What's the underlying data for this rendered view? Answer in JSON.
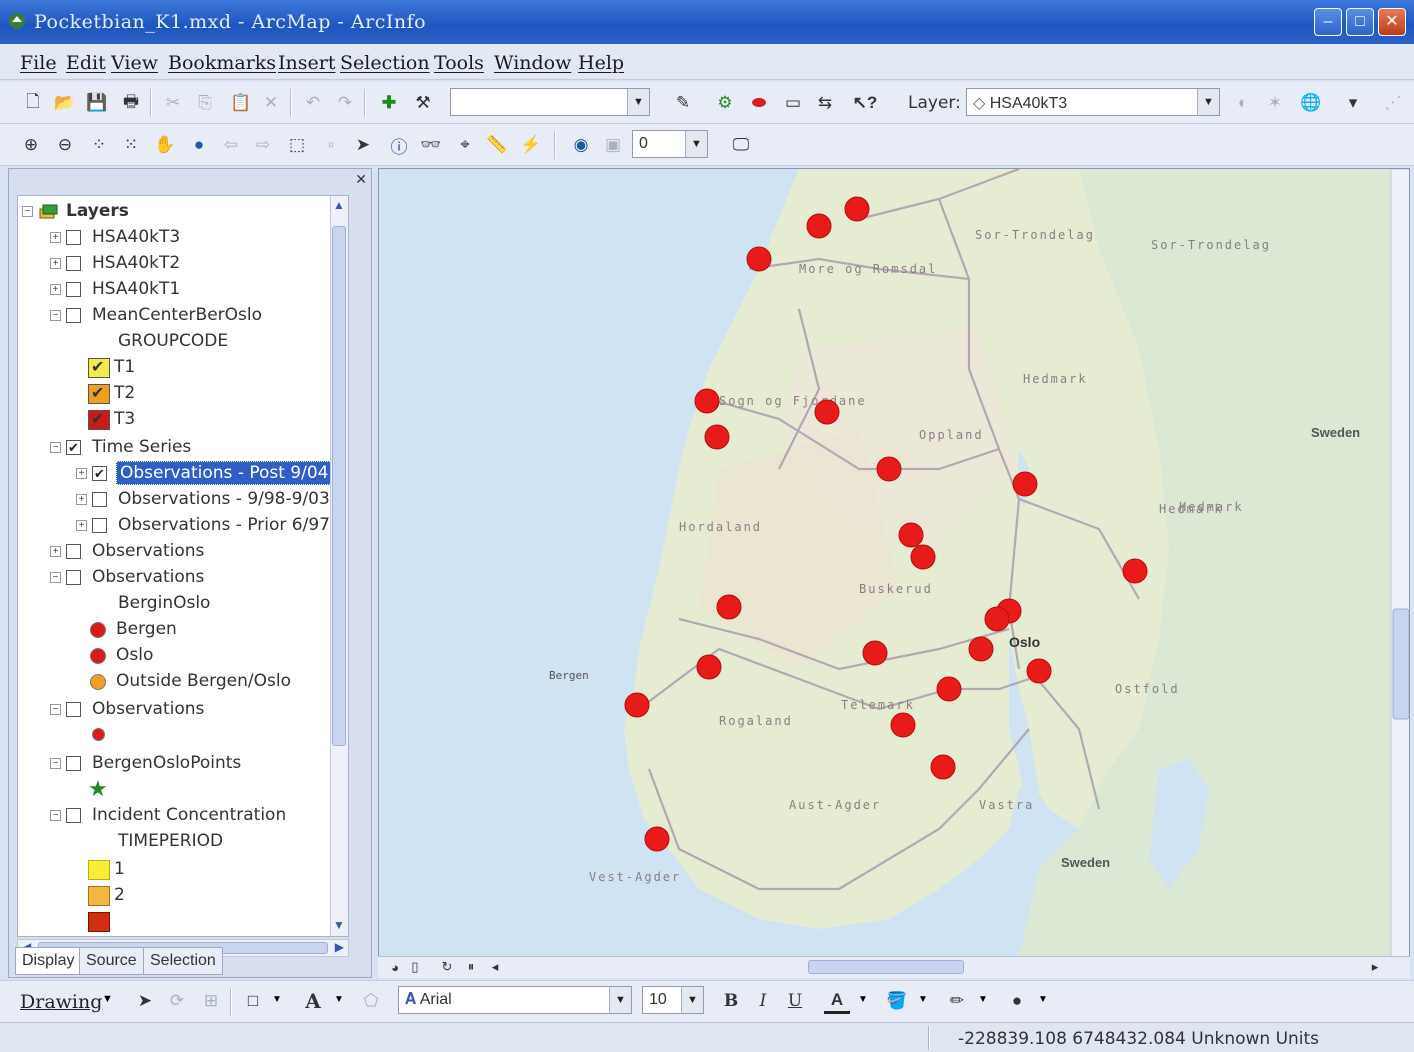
{
  "window": {
    "title": "Pocketbian_K1.mxd - ArcMap - ArcInfo",
    "minimize": "–",
    "maximize": "□",
    "close": "✕"
  },
  "menu": [
    "File",
    "Edit",
    "View",
    "Bookmarks",
    "Insert",
    "Selection",
    "Tools",
    "Window",
    "Help"
  ],
  "toolbar": {
    "layer_label": "Layer:",
    "layer_value": "HSA40kT3",
    "scale_value": "",
    "ref_value": "0"
  },
  "toc": {
    "root": "Layers",
    "rows": [
      {
        "label": "HSA40kT3"
      },
      {
        "label": "HSA40kT2"
      },
      {
        "label": "HSA40kT1"
      },
      {
        "label": "MeanCenterBerOslo"
      },
      {
        "label": "GROUPCODE"
      },
      {
        "label": "T1"
      },
      {
        "label": "T2"
      },
      {
        "label": "T3"
      },
      {
        "label": "Time Series"
      },
      {
        "label": "Observations - Post 9/04"
      },
      {
        "label": "Observations - 9/98-9/03"
      },
      {
        "label": "Observations - Prior 6/97"
      },
      {
        "label": "Observations"
      },
      {
        "label": "Observations"
      },
      {
        "label": "BerginOslo"
      },
      {
        "label": "Bergen"
      },
      {
        "label": "Oslo"
      },
      {
        "label": "Outside Bergen/Oslo"
      },
      {
        "label": "Observations"
      },
      {
        "label": "BergenOsloPoints"
      },
      {
        "label": "Incident Concentration"
      },
      {
        "label": "TIMEPERIOD"
      },
      {
        "label": "1"
      },
      {
        "label": "2"
      }
    ],
    "tabs": [
      "Display",
      "Source",
      "Selection"
    ]
  },
  "map": {
    "labels": {
      "sor_trondelag_1": "Sor-Trondelag",
      "sor_trondelag_2": "Sor-Trondelag",
      "more_romsdal": "More og Romsdal",
      "hedmark_1": "Hedmark",
      "hedmark_2": "Hedmark",
      "hedmark_3": "Hedmark",
      "sweden_1": "Sweden",
      "sweden_2": "Sweden",
      "sogn_fjordane": "Sogn og Fjordane",
      "oppland": "Oppland",
      "hordaland": "Hordaland",
      "buskerud": "Buskerud",
      "telemark": "Telemark",
      "rogaland": "Rogaland",
      "aust_agder": "Aust-Agder",
      "vest_agder": "Vest-Agder",
      "ostfold": "Ostfold",
      "oslo": "Oslo",
      "bergen": "Bergen",
      "vastra": "Vastra"
    },
    "colors": {
      "observation": "#e81b1b",
      "land": "#e8efd6",
      "water": "#cfe3f3"
    }
  },
  "drawing": {
    "label": "Drawing",
    "font": "Arial",
    "size": "10",
    "bold": "B",
    "italic": "I",
    "underline": "U"
  },
  "status": {
    "coords": "-228839.108  6748432.084 Unknown Units"
  }
}
